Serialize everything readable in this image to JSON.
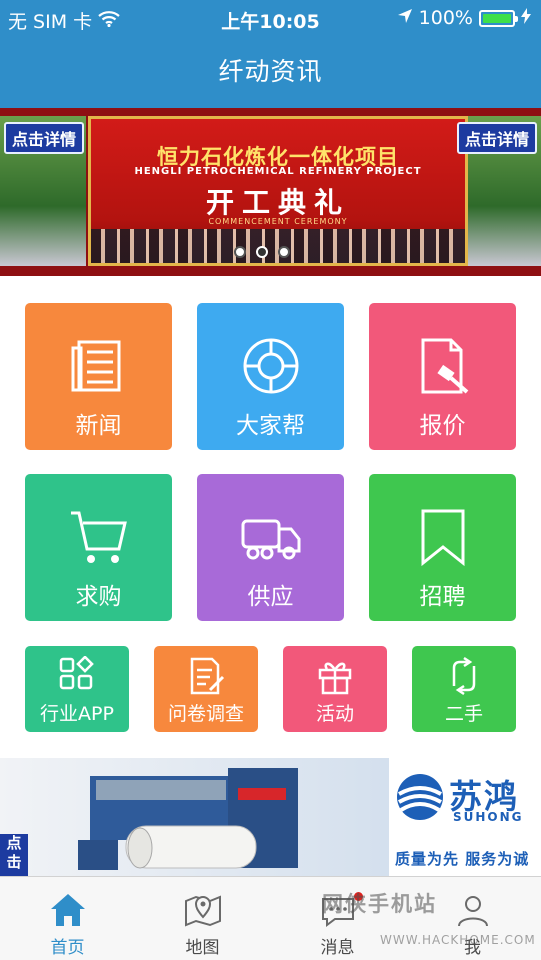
{
  "status_bar": {
    "carrier": "无 SIM 卡",
    "time": "上午10:05",
    "battery": "100%",
    "battery_level": 1.0
  },
  "header": {
    "title": "纤动资讯"
  },
  "banner": {
    "tag_left": "点击详情",
    "tag_right": "点击详情",
    "headline_cn": "恒力石化炼化一体化项目",
    "headline_en": "HENGLI PETROCHEMICAL REFINERY PROJECT",
    "event_cn": "开工典礼",
    "event_en": "COMMENCEMENT CEREMONY",
    "page_count": 3,
    "active_page": 1
  },
  "menu": {
    "big_tiles": [
      {
        "label": "新闻",
        "icon": "newspaper-icon",
        "color": "#f7883d"
      },
      {
        "label": "大家帮",
        "icon": "lifebuoy-icon",
        "color": "#3eaaf0"
      },
      {
        "label": "报价",
        "icon": "quote-document-icon",
        "color": "#f2587a"
      },
      {
        "label": "求购",
        "icon": "shopping-cart-icon",
        "color": "#2fc38a"
      },
      {
        "label": "供应",
        "icon": "truck-icon",
        "color": "#a86ad8"
      },
      {
        "label": "招聘",
        "icon": "bookmark-icon",
        "color": "#3fc74f"
      }
    ],
    "small_tiles": [
      {
        "label": "行业APP",
        "icon": "app-grid-icon",
        "color": "#2fc38a"
      },
      {
        "label": "问卷调查",
        "icon": "survey-icon",
        "color": "#f7883d"
      },
      {
        "label": "活动",
        "icon": "gift-icon",
        "color": "#f2587a"
      },
      {
        "label": "二手",
        "icon": "exchange-icon",
        "color": "#3fc74f"
      }
    ]
  },
  "ad": {
    "brand_cn": "苏鸿",
    "brand_en": "SUHONG",
    "slogan": "质量为先 服务为诚",
    "tag": "点击"
  },
  "tab_bar": {
    "items": [
      {
        "label": "首页",
        "icon": "home-icon",
        "active": true
      },
      {
        "label": "地图",
        "icon": "map-pin-icon",
        "active": false
      },
      {
        "label": "消息",
        "icon": "chat-bubble-icon",
        "active": false,
        "badge": true
      },
      {
        "label": "我",
        "icon": "person-icon",
        "active": false
      }
    ]
  },
  "watermark": {
    "cn": "网侠手机站",
    "en": "WWW.HACKHOME.COM"
  },
  "colors": {
    "brand_blue": "#2f8ec9",
    "tab_active": "#2f8ec9"
  }
}
